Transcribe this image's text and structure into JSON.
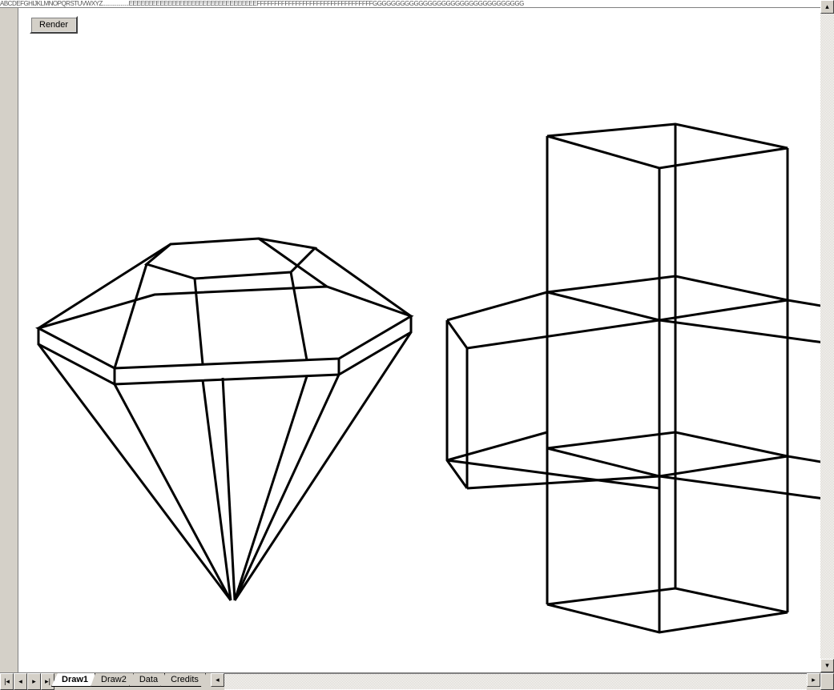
{
  "toolbar": {
    "render_label": "Render"
  },
  "tabs": {
    "active": "Draw1",
    "items": [
      "Draw1",
      "Draw2",
      "Data",
      "Credits"
    ]
  },
  "ruler": {
    "text": "ABCDEFGHIJKLMNOPQRSTUVWXYZ...................EEEEEEEEEEEEEEEEEEEEEEEEEEEEEEEEEFFFFFFFFFFFFFFFFFFFFFFFFFFFFFFFFFGGGGGGGGGGGGGGGGGGGGGGGGGGGGGGGGG"
  },
  "nav": {
    "first": "|◂",
    "prev": "◂",
    "next": "▸",
    "last": "▸|",
    "scroll_left": "◂",
    "scroll_right": "▸",
    "scroll_up": "▴",
    "scroll_down": "▾"
  }
}
